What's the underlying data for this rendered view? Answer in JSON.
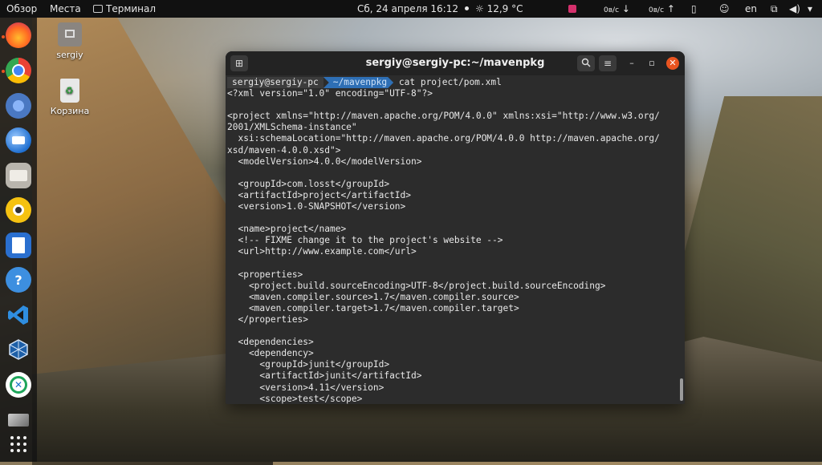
{
  "topbar": {
    "overview": "Обзор",
    "places": "Места",
    "app_name": "Терминал",
    "datetime": "Сб, 24 апреля  16:12",
    "weather": "12,9 °C",
    "net_down": "0в/с",
    "net_up": "0в/с",
    "lang": "en"
  },
  "desktop": {
    "home_label": "sergiy",
    "trash_label": "Корзина"
  },
  "terminal": {
    "title": "sergiy@sergiy-pc:~/mavenpkg",
    "prompt_user": "sergiy@sergiy-pc",
    "prompt_path": "~/mavenpkg",
    "command": "cat project/pom.xml",
    "lines": [
      "<?xml version=\"1.0\" encoding=\"UTF-8\"?>",
      "",
      "<project xmlns=\"http://maven.apache.org/POM/4.0.0\" xmlns:xsi=\"http://www.w3.org/",
      "2001/XMLSchema-instance\"",
      "  xsi:schemaLocation=\"http://maven.apache.org/POM/4.0.0 http://maven.apache.org/",
      "xsd/maven-4.0.0.xsd\">",
      "  <modelVersion>4.0.0</modelVersion>",
      "",
      "  <groupId>com.losst</groupId>",
      "  <artifactId>project</artifactId>",
      "  <version>1.0-SNAPSHOT</version>",
      "",
      "  <name>project</name>",
      "  <!-- FIXME change it to the project's website -->",
      "  <url>http://www.example.com</url>",
      "",
      "  <properties>",
      "    <project.build.sourceEncoding>UTF-8</project.build.sourceEncoding>",
      "    <maven.compiler.source>1.7</maven.compiler.source>",
      "    <maven.compiler.target>1.7</maven.compiler.target>",
      "  </properties>",
      "",
      "  <dependencies>",
      "    <dependency>",
      "      <groupId>junit</groupId>",
      "      <artifactId>junit</artifactId>",
      "      <version>4.11</version>",
      "      <scope>test</scope>"
    ]
  },
  "dock_items": [
    "firefox-icon",
    "chrome-icon",
    "chromium-icon",
    "thunderbird-icon",
    "files-icon",
    "rhythmbox-icon",
    "writer-icon",
    "help-icon",
    "vscode-icon",
    "virtualbox-icon",
    "remote-desktop-icon",
    "screenshot-icon",
    "apps-grid-icon"
  ],
  "colors": {
    "accent": "#e95420",
    "prompt_path_bg": "#2e6fb5",
    "terminal_bg": "#2c2c2c"
  }
}
